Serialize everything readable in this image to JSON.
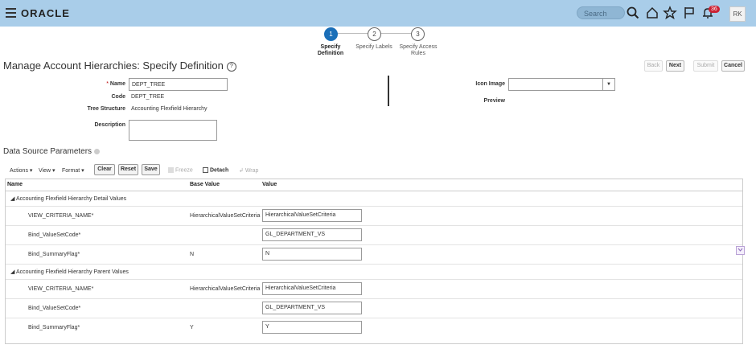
{
  "header": {
    "logo": "ORACLE",
    "search_placeholder": "Search",
    "notification_count": "36",
    "user_initials": "RK"
  },
  "train": {
    "steps": [
      {
        "number": "1",
        "label_line1": "Specify",
        "label_line2": "Definition"
      },
      {
        "number": "2",
        "label_line1": "Specify Labels",
        "label_line2": ""
      },
      {
        "number": "3",
        "label_line1": "Specify Access",
        "label_line2": "Rules"
      }
    ]
  },
  "page": {
    "title": "Manage Account Hierarchies: Specify Definition",
    "help_icon_glyph": "?",
    "buttons": {
      "back": "Back",
      "next": "Next",
      "submit": "Submit",
      "cancel": "Cancel"
    }
  },
  "form": {
    "name_label": "Name",
    "required_mark": "*",
    "name_value": "DEPT_TREE",
    "code_label": "Code",
    "code_value": "DEPT_TREE",
    "tree_structure_label": "Tree Structure",
    "tree_structure_value": "Accounting Flexfield Hierarchy",
    "description_label": "Description",
    "description_value": "",
    "icon_image_label": "Icon Image",
    "icon_image_value": "",
    "preview_label": "Preview"
  },
  "datasource": {
    "title": "Data Source Parameters",
    "toolbar": {
      "actions": "Actions",
      "view": "View",
      "format": "Format",
      "clear": "Clear",
      "reset": "Reset",
      "save": "Save",
      "freeze": "Freeze",
      "detach": "Detach",
      "wrap": "Wrap"
    },
    "columns": {
      "name": "Name",
      "base_value": "Base Value",
      "value": "Value"
    },
    "groups": [
      {
        "title": "Accounting Flexfield Hierarchy Detail Values",
        "rows": [
          {
            "name": "VIEW_CRITERIA_NAME*",
            "base": "HierarchicalValueSetCriteria",
            "value": "HierarchicalValueSetCriteria"
          },
          {
            "name": "Bind_ValueSetCode*",
            "base": "",
            "value": "GL_DEPARTMENT_VS"
          },
          {
            "name": "Bind_SummaryFlag*",
            "base": "N",
            "value": "N"
          }
        ]
      },
      {
        "title": "Accounting Flexfield Hierarchy Parent Values",
        "rows": [
          {
            "name": "VIEW_CRITERIA_NAME*",
            "base": "HierarchicalValueSetCriteria",
            "value": "HierarchicalValueSetCriteria"
          },
          {
            "name": "Bind_ValueSetCode*",
            "base": "",
            "value": "GL_DEPARTMENT_VS"
          },
          {
            "name": "Bind_SummaryFlag*",
            "base": "Y",
            "value": "Y"
          }
        ]
      }
    ]
  },
  "colors": {
    "topbar": "#a9cde9",
    "active_step": "#1b6fb8",
    "badge": "#cc2233"
  }
}
